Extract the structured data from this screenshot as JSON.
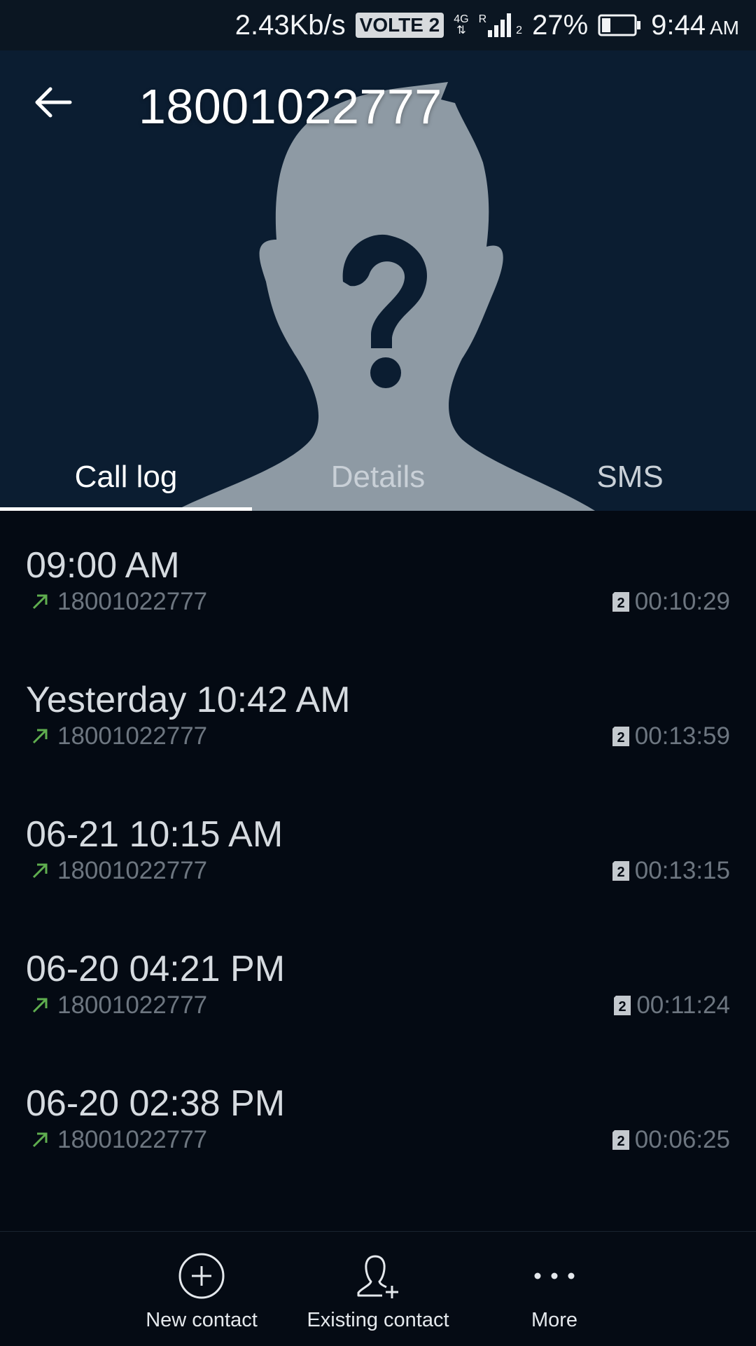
{
  "status_bar": {
    "speed": "2.43Kb/s",
    "volte": "VOLTE 2",
    "network": "4G",
    "roaming": "R",
    "sim_index": "2",
    "battery": "27%",
    "time": "9:44",
    "ampm": "AM"
  },
  "header": {
    "title": "18001022777",
    "back_icon": "arrow-left-icon",
    "avatar_icon": "unknown-person-icon"
  },
  "tabs": [
    {
      "label": "Call log",
      "active": true
    },
    {
      "label": "Details",
      "active": false
    },
    {
      "label": "SMS",
      "active": false
    }
  ],
  "call_log": [
    {
      "time": "09:00 AM",
      "number": "18001022777",
      "sim": "2",
      "duration": "00:10:29",
      "direction": "outgoing"
    },
    {
      "time": "Yesterday 10:42 AM",
      "number": "18001022777",
      "sim": "2",
      "duration": "00:13:59",
      "direction": "outgoing"
    },
    {
      "time": "06-21 10:15 AM",
      "number": "18001022777",
      "sim": "2",
      "duration": "00:13:15",
      "direction": "outgoing"
    },
    {
      "time": "06-20 04:21 PM",
      "number": "18001022777",
      "sim": "2",
      "duration": "00:11:24",
      "direction": "outgoing"
    },
    {
      "time": "06-20 02:38 PM",
      "number": "18001022777",
      "sim": "2",
      "duration": "00:06:25",
      "direction": "outgoing"
    }
  ],
  "bottom_bar": {
    "new_contact": {
      "label": "New contact",
      "icon": "plus-circle-icon"
    },
    "existing_contact": {
      "label": "Existing contact",
      "icon": "person-add-icon"
    },
    "more": {
      "label": "More",
      "icon": "more-dots-icon"
    }
  },
  "colors": {
    "header_bg": "#0b1d31",
    "list_bg": "#040a13",
    "outgoing_arrow": "#5fae4f",
    "avatar": "#8e9aa4"
  }
}
